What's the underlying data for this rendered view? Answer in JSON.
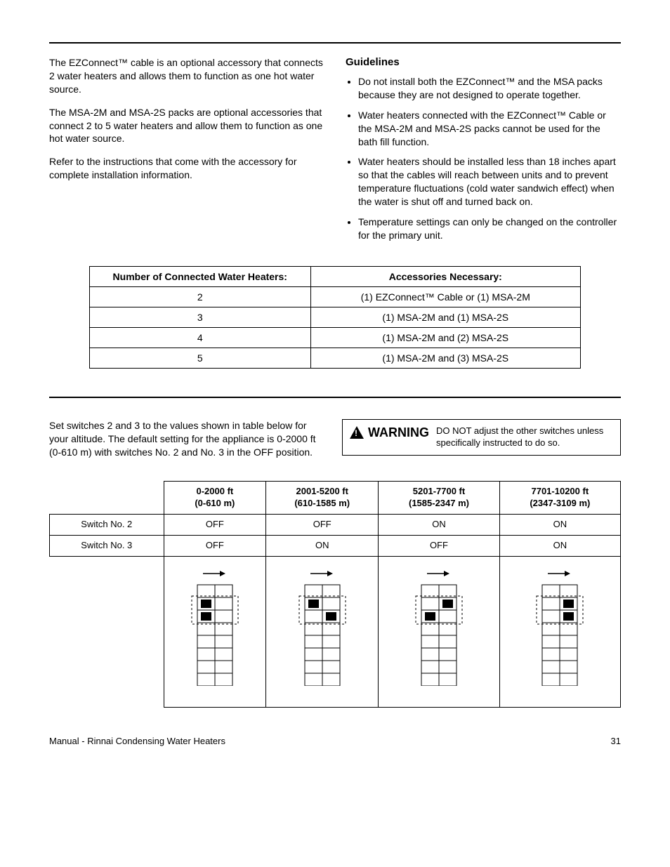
{
  "intro": {
    "p1": "The EZConnect™ cable is an optional accessory that connects 2 water heaters and allows them to function as one hot water source.",
    "p2": "The MSA-2M and MSA-2S packs are optional accessories that connect 2 to 5 water heaters and allow them to function as one hot water source.",
    "p3": "Refer to the instructions that come with the accessory for complete installation information."
  },
  "guidelines": {
    "heading": "Guidelines",
    "items": [
      "Do not install both the EZConnect™ and the MSA packs because they are not designed to operate together.",
      "Water heaters connected with the EZConnect™ Cable or the MSA-2M and MSA-2S packs cannot be used for the bath fill function.",
      "Water heaters should be installed less than 18 inches apart so that the cables will reach between units and to prevent temperature fluctuations (cold water sandwich effect) when the water is shut off and turned back on.",
      "Temperature settings can only be changed on the controller for the primary unit."
    ]
  },
  "acc_table": {
    "head1": "Number of Connected Water Heaters:",
    "head2": "Accessories Necessary:",
    "rows": [
      {
        "n": "2",
        "a": "(1) EZConnect™ Cable or (1) MSA-2M"
      },
      {
        "n": "3",
        "a": "(1) MSA-2M and (1) MSA-2S"
      },
      {
        "n": "4",
        "a": "(1) MSA-2M and (2) MSA-2S"
      },
      {
        "n": "5",
        "a": "(1) MSA-2M and (3) MSA-2S"
      }
    ]
  },
  "altitude": {
    "text": "Set switches 2 and 3 to the values shown in table below for your altitude.  The default setting for the appliance is 0-2000 ft (0-610 m) with switches No. 2 and No. 3 in the OFF position.",
    "warning_label": "WARNING",
    "warning_text": "DO NOT adjust the other switches unless specifically instructed to do so.",
    "cols": [
      {
        "ft": "0-2000 ft",
        "m": "(0-610 m)",
        "s2": "OFF",
        "s3": "OFF"
      },
      {
        "ft": "2001-5200 ft",
        "m": "(610-1585 m)",
        "s2": "OFF",
        "s3": "ON"
      },
      {
        "ft": "5201-7700 ft",
        "m": "(1585-2347 m)",
        "s2": "ON",
        "s3": "OFF"
      },
      {
        "ft": "7701-10200 ft",
        "m": "(2347-3109 m)",
        "s2": "ON",
        "s3": "ON"
      }
    ],
    "rowlabels": {
      "s2": "Switch No. 2",
      "s3": "Switch No. 3"
    }
  },
  "footer": {
    "title": "Manual - Rinnai Condensing Water Heaters",
    "page": "31"
  }
}
